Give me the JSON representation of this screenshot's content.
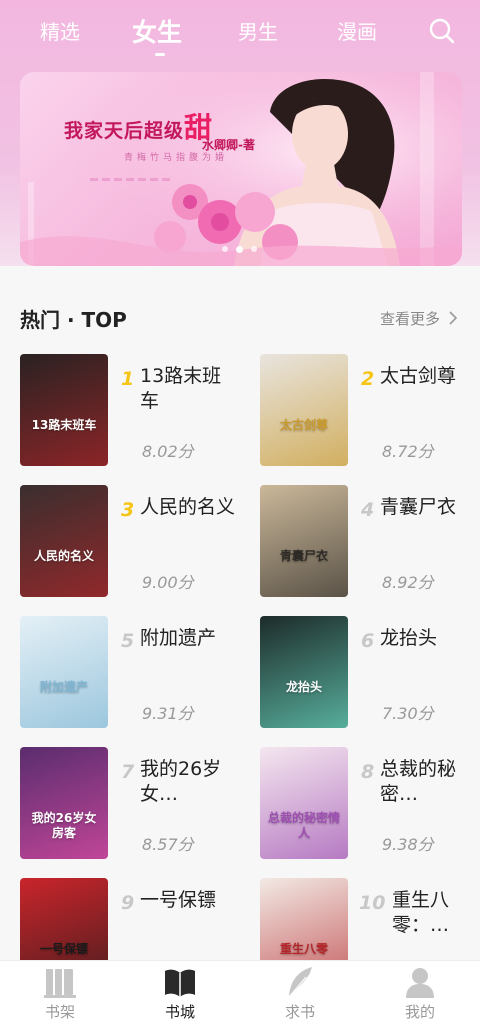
{
  "top_nav": {
    "tabs": [
      {
        "label": "精选",
        "active": false
      },
      {
        "label": "女生",
        "active": true
      },
      {
        "label": "男生",
        "active": false
      },
      {
        "label": "漫画",
        "active": false
      }
    ],
    "search_icon": "search-icon"
  },
  "banner": {
    "title_lead": "我家天后超级",
    "title_big": "甜",
    "author": "水卿卿-著",
    "tagline": "青梅竹马指腹为婚",
    "dots": 3,
    "active_dot": 1
  },
  "hot": {
    "title": "热门 · TOP",
    "see_more": "查看更多"
  },
  "books": [
    {
      "rank": "1",
      "name": "13路末班车",
      "score": "8.02分",
      "cover": {
        "bg": "#2a2222",
        "accent": "#b3262a",
        "text": "13路末班车"
      }
    },
    {
      "rank": "2",
      "name": "太古剑尊",
      "score": "8.72分",
      "cover": {
        "bg": "#e8e4de",
        "accent": "#c99a2e",
        "text": "太古剑尊"
      }
    },
    {
      "rank": "3",
      "name": "人民的名义",
      "score": "9.00分",
      "cover": {
        "bg": "#3a2e2e",
        "accent": "#b3262a",
        "text": "人民的名义"
      }
    },
    {
      "rank": "4",
      "name": "青囊尸衣",
      "score": "8.92分",
      "cover": {
        "bg": "#cbb89a",
        "accent": "#2d2a26",
        "text": "青囊尸衣"
      }
    },
    {
      "rank": "5",
      "name": "附加遗产",
      "score": "9.31分",
      "cover": {
        "bg": "#e4f0f6",
        "accent": "#7fb6d4",
        "text": "附加遗产"
      }
    },
    {
      "rank": "6",
      "name": "龙抬头",
      "score": "7.30分",
      "cover": {
        "bg": "#1d2b2a",
        "accent": "#6ee2c9",
        "text": "龙抬头"
      }
    },
    {
      "rank": "7",
      "name": "我的26岁女…",
      "score": "8.57分",
      "cover": {
        "bg": "#5a2d6e",
        "accent": "#e94fa8",
        "text": "我的26岁女房客"
      }
    },
    {
      "rank": "8",
      "name": "总裁的秘密…",
      "score": "9.38分",
      "cover": {
        "bg": "#f4e6ef",
        "accent": "#9d4fb1",
        "text": "总裁的秘密情人"
      }
    },
    {
      "rank": "9",
      "name": "一号保镖",
      "score": "",
      "cover": {
        "bg": "#c9252b",
        "accent": "#1a1a1a",
        "text": "一号保镖"
      }
    },
    {
      "rank": "10",
      "name": "重生八零：…",
      "score": "",
      "cover": {
        "bg": "#f2e9e4",
        "accent": "#b3262a",
        "text": "重生八零"
      }
    }
  ],
  "colors": {
    "rank_top": "#f5c518",
    "rank_rest": "#c8c8c8"
  },
  "bottom_nav": [
    {
      "label": "书架",
      "icon": "bookshelf-icon",
      "active": false
    },
    {
      "label": "书城",
      "icon": "book-open-icon",
      "active": true
    },
    {
      "label": "求书",
      "icon": "feather-icon",
      "active": false
    },
    {
      "label": "我的",
      "icon": "user-icon",
      "active": false
    }
  ]
}
